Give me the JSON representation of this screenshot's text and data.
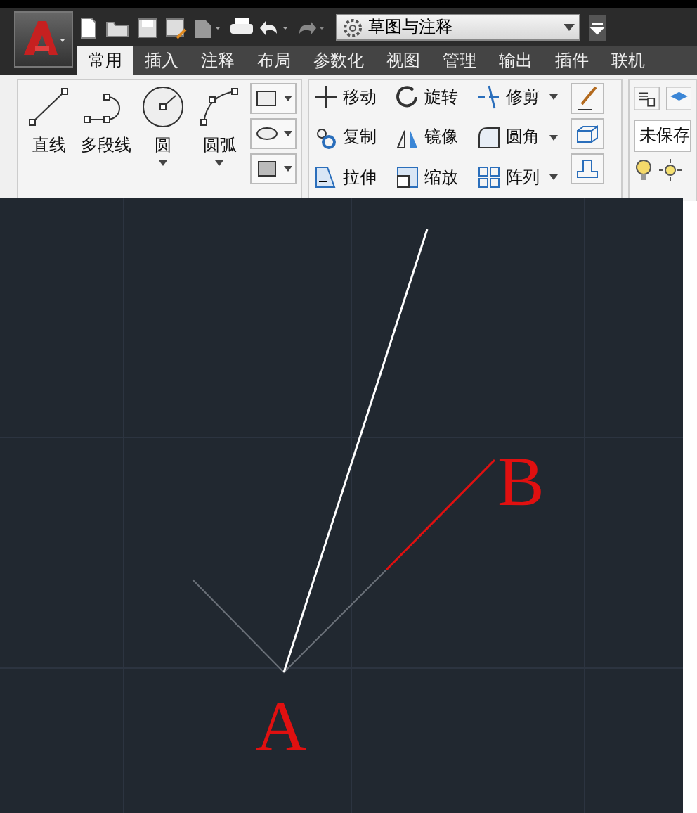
{
  "workspace": {
    "value": "草图与注释"
  },
  "tabs": [
    {
      "label": "常用",
      "selected": true
    },
    {
      "label": "插入",
      "selected": false
    },
    {
      "label": "注释",
      "selected": false
    },
    {
      "label": "布局",
      "selected": false
    },
    {
      "label": "参数化",
      "selected": false
    },
    {
      "label": "视图",
      "selected": false
    },
    {
      "label": "管理",
      "selected": false
    },
    {
      "label": "输出",
      "selected": false
    },
    {
      "label": "插件",
      "selected": false
    },
    {
      "label": "联机",
      "selected": false
    }
  ],
  "draw_tools": [
    {
      "kind": "line",
      "label": "直线",
      "has_menu": false
    },
    {
      "kind": "polyline",
      "label": "多段线",
      "has_menu": false
    },
    {
      "kind": "circle",
      "label": "圆",
      "has_menu": true
    },
    {
      "kind": "arc",
      "label": "圆弧",
      "has_menu": true
    }
  ],
  "modify_tools": [
    {
      "kind": "move",
      "label": "移动",
      "has_menu": false
    },
    {
      "kind": "rotate",
      "label": "旋转",
      "has_menu": false
    },
    {
      "kind": "trim",
      "label": "修剪",
      "has_menu": true
    },
    {
      "kind": "copy",
      "label": "复制",
      "has_menu": false
    },
    {
      "kind": "mirror",
      "label": "镜像",
      "has_menu": false
    },
    {
      "kind": "fillet",
      "label": "圆角",
      "has_menu": true
    },
    {
      "kind": "stretch",
      "label": "拉伸",
      "has_menu": false
    },
    {
      "kind": "scale",
      "label": "缩放",
      "has_menu": false
    },
    {
      "kind": "array",
      "label": "阵列",
      "has_menu": true
    }
  ],
  "layer_field": {
    "value": "未保存"
  },
  "canvas": {
    "labels": [
      "A",
      "B"
    ]
  }
}
